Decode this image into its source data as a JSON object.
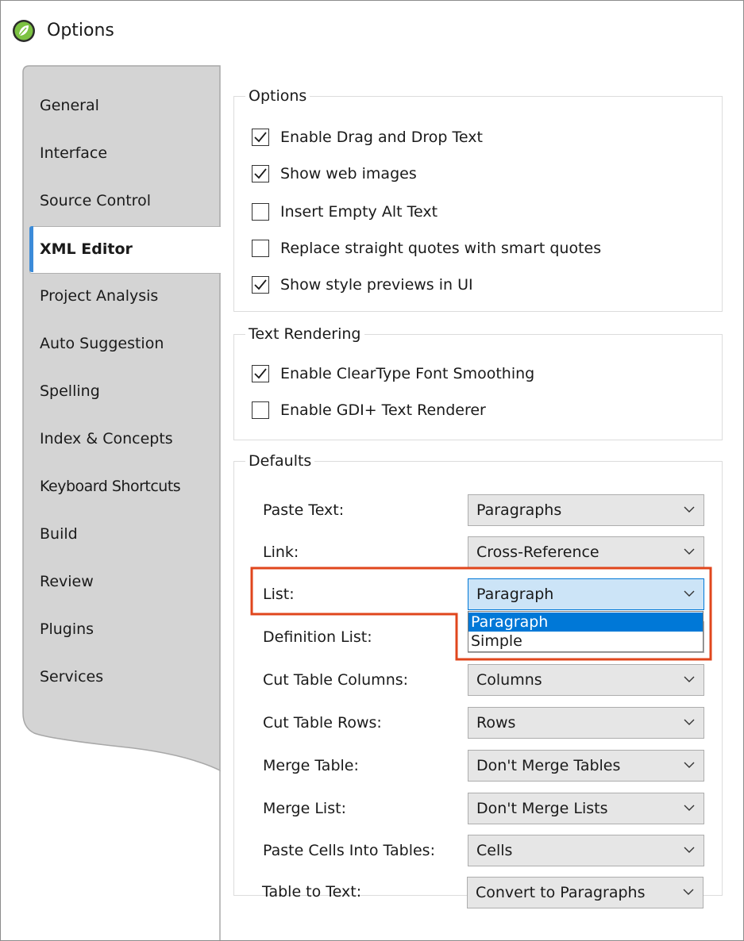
{
  "window": {
    "title": "Options"
  },
  "sidebar": {
    "items": [
      {
        "label": "General"
      },
      {
        "label": "Interface"
      },
      {
        "label": "Source Control"
      },
      {
        "label": "XML Editor",
        "active": true
      },
      {
        "label": "Project Analysis"
      },
      {
        "label": "Auto Suggestion"
      },
      {
        "label": "Spelling"
      },
      {
        "label": "Index & Concepts"
      },
      {
        "label": "Keyboard Shortcuts"
      },
      {
        "label": "Build"
      },
      {
        "label": "Review"
      },
      {
        "label": "Plugins"
      },
      {
        "label": "Services"
      }
    ]
  },
  "options_group": {
    "title": "Options",
    "items": [
      {
        "label": "Enable Drag and Drop Text",
        "checked": true
      },
      {
        "label": "Show web images",
        "checked": true
      },
      {
        "label": "Insert Empty Alt Text",
        "checked": false
      },
      {
        "label": "Replace straight quotes with smart quotes",
        "checked": false
      },
      {
        "label": "Show style previews in UI",
        "checked": true
      }
    ]
  },
  "text_rendering_group": {
    "title": "Text Rendering",
    "items": [
      {
        "label": "Enable ClearType Font Smoothing",
        "checked": true
      },
      {
        "label": "Enable GDI+ Text Renderer",
        "checked": false
      }
    ]
  },
  "defaults_group": {
    "title": "Defaults",
    "rows": [
      {
        "label": "Paste Text:",
        "value": "Paragraphs"
      },
      {
        "label": "Link:",
        "value": "Cross-Reference"
      },
      {
        "label": "List:",
        "value": "Paragraph",
        "open": true
      },
      {
        "label": "Definition List:",
        "value": ""
      },
      {
        "label": "Cut Table Columns:",
        "value": "Columns"
      },
      {
        "label": "Cut Table Rows:",
        "value": "Rows"
      },
      {
        "label": "Merge Table:",
        "value": "Don't Merge Tables"
      },
      {
        "label": "Merge List:",
        "value": "Don't Merge Lists"
      },
      {
        "label": "Paste Cells Into Tables:",
        "value": "Cells"
      },
      {
        "label": "Table to Text:",
        "value": "Convert to Paragraphs"
      }
    ],
    "list_dropdown_options": [
      {
        "label": "Paragraph",
        "highlighted": true
      },
      {
        "label": "Simple",
        "highlighted": false
      }
    ]
  },
  "colors": {
    "accent": "#0078d7",
    "annotation_highlight": "#e0461c",
    "sidebar_bg": "#d4d4d4"
  }
}
